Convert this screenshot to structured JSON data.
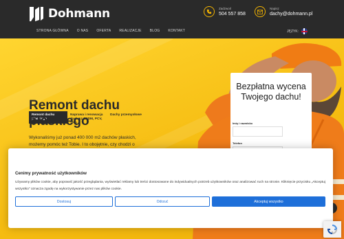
{
  "brand": {
    "name": "Dohmann"
  },
  "contact": [
    {
      "label": "Zadzwoń",
      "value": "504 557 858",
      "icon": "phone-icon"
    },
    {
      "label": "Napisz",
      "value": "dachy@dohmann.pl",
      "icon": "mail-icon"
    }
  ],
  "nav": [
    "STRONA GŁÓWNA",
    "O NAS",
    "OFERTA",
    "REALIZACJE",
    "BLOG",
    "KONTAKT"
  ],
  "lang": {
    "label": "JĘZYK:"
  },
  "tabs": [
    {
      "label": "Remont dachu płaskiego",
      "active": true
    },
    {
      "label": "Naprawa i renowacja dachu z EPDM, PCV, TPO",
      "active": false
    },
    {
      "label": "Dachy przemysłowe",
      "active": false
    }
  ],
  "hero": {
    "headline": "Remont dachu płaskiego",
    "lead": "Wykonaliśmy już ponad 400 000 m2 dachów płaskich, możemy pomóc też Tobie. I to obojętnie, czy chodzi o"
  },
  "form": {
    "title": "Bezpłatna wycena Twojego dachu!",
    "name_label": "Imię i nazwisko",
    "phone_label": "Telefon"
  },
  "cookie": {
    "title": "Cenimy prywatność użytkowników",
    "text": "Używamy plików cookie, aby poprawić jakość przeglądania, wyświetlać reklamy lub treści dostosowane do indywidualnych potrzeb użytkowników oraz analizować ruch na stronie. Kliknięcie przycisku „Akceptuj wszystko” oznacza zgodę na wykorzystywanie przez nas plików cookie.",
    "customize": "Dostosuj",
    "reject": "Odrzuć",
    "accept": "Akceptuj wszystko"
  },
  "colors": {
    "header": "#2a2a2a",
    "accent": "#f4b400",
    "primary": "#1e6fd9"
  }
}
